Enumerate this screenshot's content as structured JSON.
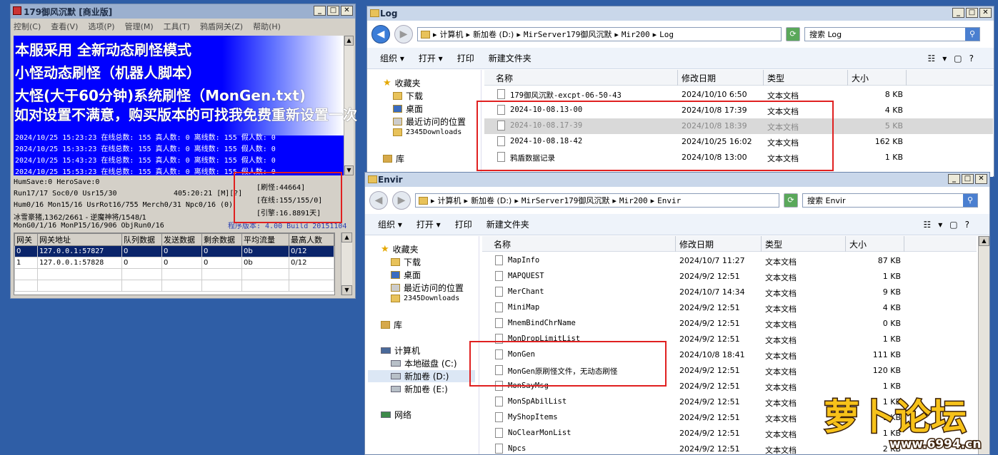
{
  "server": {
    "title": "179御风沉默 [商业版]",
    "menu": [
      "控制(C)",
      "查看(V)",
      "选项(P)",
      "管理(M)",
      "工具(T)",
      "鸦盾网关(Z)",
      "帮助(H)"
    ],
    "overlay": [
      "本服采用 全新动态刷怪模式",
      "小怪动态刷怪（机器人脚本）",
      "大怪(大于60分钟)系统刷怪（MonGen.txt)",
      "如对设置不满意，购买版本的可找我免费重新设置一次"
    ],
    "log_lines": [
      "2024/10/25 15:23:23 在线总数: 155 真人数: 0 离线数: 155 假人数: 0",
      "2024/10/25 15:33:23 在线总数: 155 真人数: 0 离线数: 155 假人数: 0",
      "2024/10/25 15:43:23 在线总数: 155 真人数: 0 离线数: 155 假人数: 0",
      "2024/10/25 15:53:23 在线总数: 155 真人数: 0 离线数: 155 假人数: 0"
    ],
    "stats": {
      "line1": "HumSave:0 HeroSave:0",
      "line2a": "Run17/17 Soc0/0 Usr15/30",
      "line2b": "405:20:21 [M][?]",
      "line3": "Hum0/16 Mon15/16 UsrRot16/755 Merch0/31 Npc0/16 (0)",
      "line4": "冰雪豪猪,1362/2661 - 逆魔神将/1548/1",
      "line5": "MonG0/1/16 MonP15/16/906 ObjRun0/16",
      "refresh": "[刷怪:44664]",
      "online": "[在线:155/155/0]",
      "engine": "[引擎:16.8891天]",
      "version": "程序版本: 4.00 Build 20151104"
    },
    "grid_headers": [
      "网关",
      "网关地址",
      "队列数据",
      "发送数据",
      "剩余数据",
      "平均流量",
      "最高人数"
    ],
    "grid_rows": [
      [
        "0",
        "127.0.0.1:57827",
        "0",
        "0",
        "0",
        "0b",
        "0/12"
      ],
      [
        "1",
        "127.0.0.1:57828",
        "0",
        "0",
        "0",
        "0b",
        "0/12"
      ]
    ]
  },
  "log_win": {
    "title": "Log",
    "path": [
      "计算机",
      "新加卷 (D:)",
      "MirServer179御风沉默",
      "Mir200",
      "Log"
    ],
    "search_placeholder": "搜索 Log",
    "toolbar": [
      "组织 ▾",
      "打开 ▾",
      "打印",
      "新建文件夹"
    ],
    "nav": [
      "收藏夹",
      "下载",
      "桌面",
      "最近访问的位置",
      "2345Downloads",
      "库"
    ],
    "columns": [
      "名称",
      "修改日期",
      "类型",
      "大小"
    ],
    "files": [
      {
        "name": "179御风沉默-excpt-06-50-43",
        "date": "2024/10/10 6:50",
        "type": "文本文档",
        "size": "8 KB"
      },
      {
        "name": "2024-10-08.13-00",
        "date": "2024/10/8 17:39",
        "type": "文本文档",
        "size": "4 KB"
      },
      {
        "name": "2024-10-08.17-39",
        "date": "2024/10/8 18:39",
        "type": "文本文档",
        "size": "5 KB"
      },
      {
        "name": "2024-10-08.18-42",
        "date": "2024/10/25 16:02",
        "type": "文本文档",
        "size": "162 KB"
      },
      {
        "name": "鸦盾数据记录",
        "date": "2024/10/8 13:00",
        "type": "文本文档",
        "size": "1 KB"
      }
    ]
  },
  "envir_win": {
    "title": "Envir",
    "path": [
      "计算机",
      "新加卷 (D:)",
      "MirServer179御风沉默",
      "Mir200",
      "Envir"
    ],
    "search_placeholder": "搜索 Envir",
    "toolbar": [
      "组织 ▾",
      "打开 ▾",
      "打印",
      "新建文件夹"
    ],
    "nav": [
      "收藏夹",
      "下载",
      "桌面",
      "最近访问的位置",
      "2345Downloads",
      "库",
      "计算机",
      "本地磁盘 (C:)",
      "新加卷 (D:)",
      "新加卷 (E:)",
      "网络"
    ],
    "columns": [
      "名称",
      "修改日期",
      "类型",
      "大小"
    ],
    "files": [
      {
        "name": "MapInfo",
        "date": "2024/10/7 11:27",
        "type": "文本文档",
        "size": "87 KB"
      },
      {
        "name": "MAPQUEST",
        "date": "2024/9/2 12:51",
        "type": "文本文档",
        "size": "1 KB"
      },
      {
        "name": "MerChant",
        "date": "2024/10/7 14:34",
        "type": "文本文档",
        "size": "9 KB"
      },
      {
        "name": "MiniMap",
        "date": "2024/9/2 12:51",
        "type": "文本文档",
        "size": "4 KB"
      },
      {
        "name": "MnemBindChrName",
        "date": "2024/9/2 12:51",
        "type": "文本文档",
        "size": "0 KB"
      },
      {
        "name": "MonDropLimitList",
        "date": "2024/9/2 12:51",
        "type": "文本文档",
        "size": "1 KB"
      },
      {
        "name": "MonGen",
        "date": "2024/10/8 18:41",
        "type": "文本文档",
        "size": "111 KB"
      },
      {
        "name": "MonGen原刷怪文件，无动态刷怪",
        "date": "2024/9/2 12:51",
        "type": "文本文档",
        "size": "120 KB"
      },
      {
        "name": "MonSayMsg",
        "date": "2024/9/2 12:51",
        "type": "文本文档",
        "size": "1 KB"
      },
      {
        "name": "MonSpAbilList",
        "date": "2024/9/2 12:51",
        "type": "文本文档",
        "size": "1 KB"
      },
      {
        "name": "MyShopItems",
        "date": "2024/9/2 12:51",
        "type": "文本文档",
        "size": "1 KB"
      },
      {
        "name": "NoClearMonList",
        "date": "2024/9/2 12:51",
        "type": "文本文档",
        "size": "1 KB"
      },
      {
        "name": "Npcs",
        "date": "2024/9/2 12:51",
        "type": "文本文档",
        "size": "2 KB"
      }
    ]
  },
  "watermark": {
    "main": "萝卜论坛",
    "url": "www.6994.cn"
  }
}
